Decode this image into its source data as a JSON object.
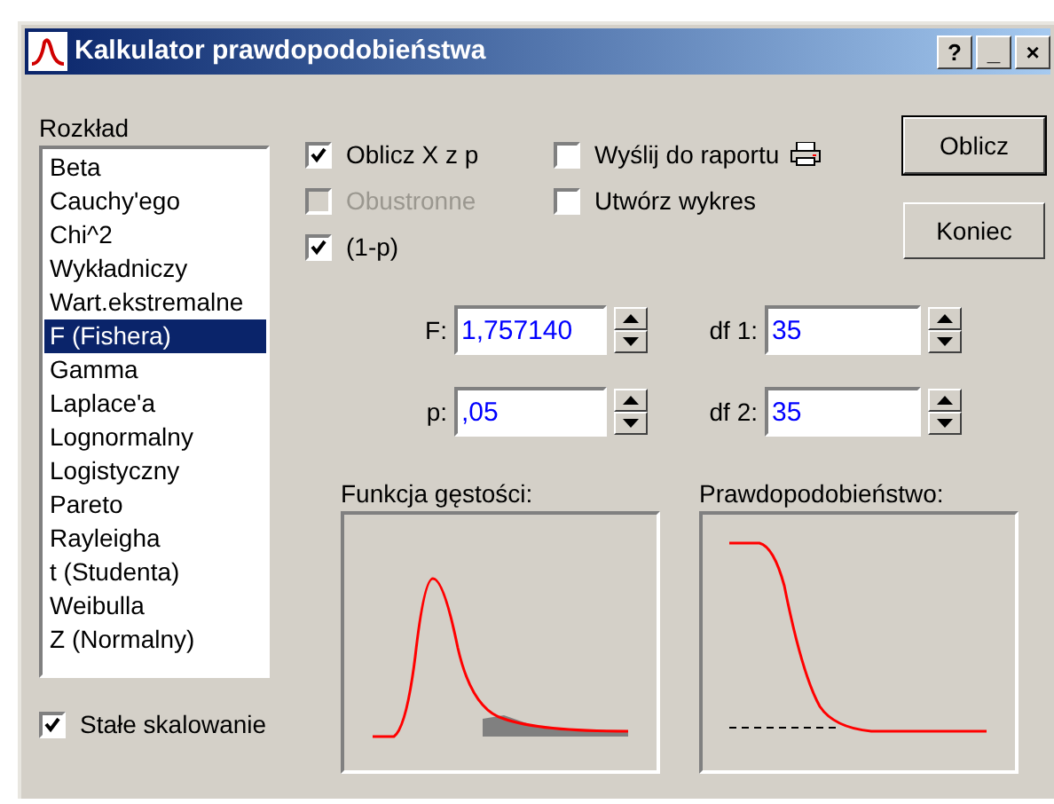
{
  "window": {
    "title": "Kalkulator prawdopodobieństwa",
    "title_buttons": [
      "?",
      "_",
      "×"
    ]
  },
  "distribution": {
    "label": "Rozkład",
    "items": [
      {
        "label": "Beta",
        "selected": false
      },
      {
        "label": "Cauchy'ego",
        "selected": false
      },
      {
        "label": "Chi^2",
        "selected": false
      },
      {
        "label": "Wykładniczy",
        "selected": false
      },
      {
        "label": "Wart.ekstremalne",
        "selected": false
      },
      {
        "label": "F (Fishera)",
        "selected": true
      },
      {
        "label": "Gamma",
        "selected": false
      },
      {
        "label": "Laplace'a",
        "selected": false
      },
      {
        "label": "Lognormalny",
        "selected": false
      },
      {
        "label": "Logistyczny",
        "selected": false
      },
      {
        "label": "Pareto",
        "selected": false
      },
      {
        "label": "Rayleigha",
        "selected": false
      },
      {
        "label": "t (Studenta)",
        "selected": false
      },
      {
        "label": "Weibulla",
        "selected": false
      },
      {
        "label": "Z (Normalny)",
        "selected": false
      }
    ]
  },
  "fixed_scaling": {
    "label": "Stałe skalowanie",
    "checked": true,
    "disabled": false
  },
  "options_left": [
    {
      "label": "Oblicz X z p",
      "checked": true,
      "disabled": false
    },
    {
      "label": "Obustronne",
      "checked": false,
      "disabled": true
    },
    {
      "label": "(1-p)",
      "checked": true,
      "disabled": false
    }
  ],
  "options_right": [
    {
      "label": "Wyślij do raportu",
      "checked": false,
      "disabled": false,
      "printer": true
    },
    {
      "label": "Utwórz wykres",
      "checked": false,
      "disabled": false,
      "printer": false
    }
  ],
  "buttons": [
    "Oblicz",
    "Koniec"
  ],
  "fields": [
    {
      "label": "F:",
      "value": "1,757140"
    },
    {
      "label": "df 1:",
      "value": "35"
    },
    {
      "label": "p:",
      "value": ",05"
    },
    {
      "label": "df 2:",
      "value": "35"
    }
  ],
  "charts": [
    {
      "label": "Funkcja gęstości:",
      "kind": "density"
    },
    {
      "label": "Prawdopodobieństwo:",
      "kind": "probability"
    }
  ]
}
